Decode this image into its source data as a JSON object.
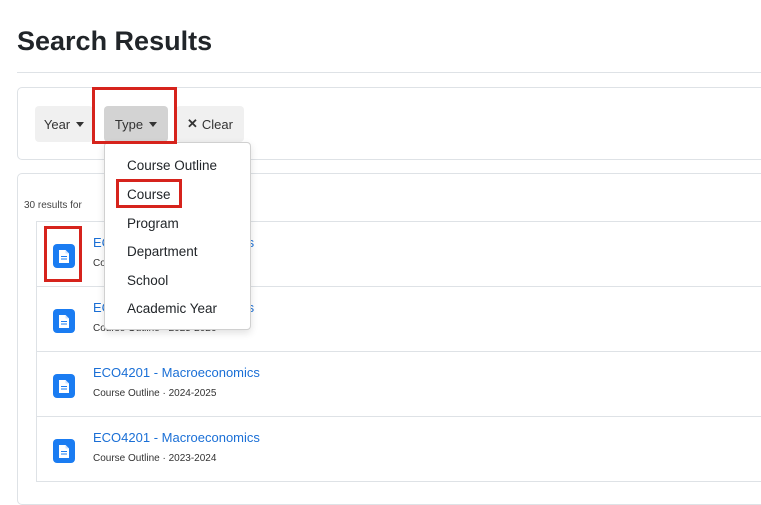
{
  "page": {
    "title": "Search Results"
  },
  "filters": {
    "year_label": "Year",
    "type_label": "Type",
    "clear_label": "Clear",
    "clear_icon": "x-icon"
  },
  "type_dropdown": {
    "open": true,
    "items": [
      "Course Outline",
      "Course",
      "Program",
      "Department",
      "School",
      "Academic Year"
    ],
    "highlighted": "Course"
  },
  "results": {
    "count_text": "30 results for",
    "items": [
      {
        "title_visible": "EC",
        "title_tail": "nics",
        "meta": "Co"
      },
      {
        "title_visible": "EC",
        "title_tail": "nics",
        "meta": "Course Outline · 2025-2026"
      },
      {
        "title": "ECO4201 - Macroeconomics",
        "meta": "Course Outline · 2024-2025"
      },
      {
        "title": "ECO4201 - Macroeconomics",
        "meta": "Course Outline · 2023-2024"
      }
    ]
  },
  "colors": {
    "accent_link": "#1a6fd6",
    "doc_icon_bg": "#1a7cf2",
    "annotation_red": "#d6231c"
  },
  "annotations": [
    "type-button-highlight",
    "course-option-highlight",
    "first-result-icon-highlight"
  ]
}
